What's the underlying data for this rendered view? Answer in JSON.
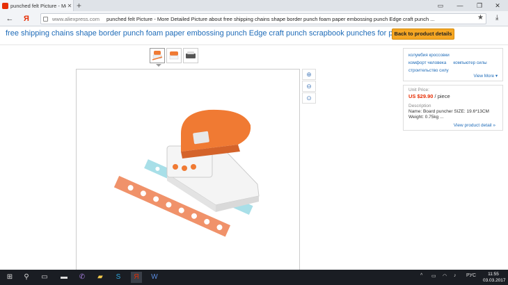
{
  "browser": {
    "tab_title": "punched felt Picture - Mo",
    "url_domain": "www.aliexpress.com",
    "url_title": "punched felt Picture - More Detailed Picture about free shipping chains shape border punch foam paper embossing punch Edge craft punch ..."
  },
  "page": {
    "title": "free shipping chains shape border punch foam paper embossing punch Edge craft punch scrapbook punches for paper cut",
    "back_button": "Back to product details"
  },
  "related": {
    "tags": [
      "колумбия кроссовки",
      "комфорт человека",
      "компьютер силы",
      "строительство силу"
    ],
    "view_more": "View More ▾"
  },
  "price_info": {
    "label": "Unit Price:",
    "price": "US $29.90",
    "unit": " / piece",
    "desc_label": "Description",
    "desc_line1": "Name: Board puncher SIZE: 19.6*13CM",
    "desc_line2": "Weight: 0.75kg     ...",
    "view_product": "View product detail »"
  },
  "taskbar": {
    "lang": "РУС",
    "time": "11:55",
    "date": "03.03.2017"
  },
  "colors": {
    "accent_orange": "#f5a623",
    "link_blue": "#1e6bb8",
    "price_red": "#e62e04"
  }
}
